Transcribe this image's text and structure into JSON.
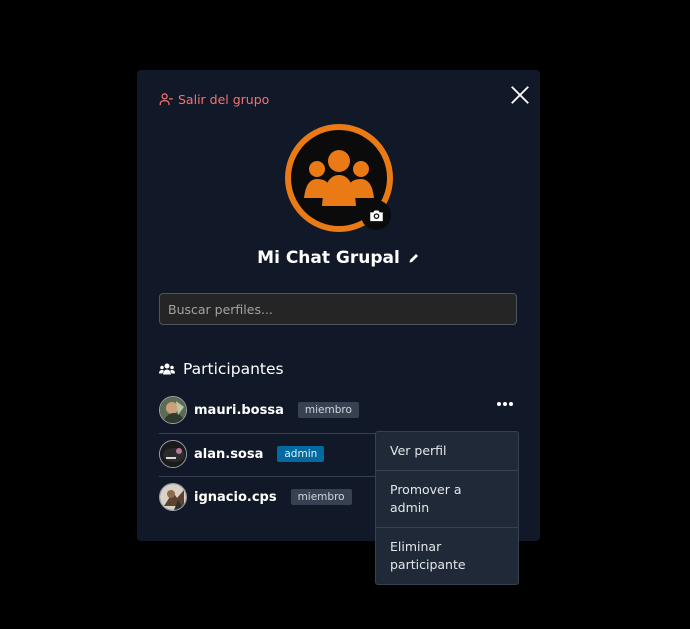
{
  "modal": {
    "leave_label": "Salir del grupo",
    "group_name": "Mi Chat Grupal",
    "search_placeholder": "Buscar perfiles...",
    "section_title": "Participantes"
  },
  "participants": [
    {
      "username": "mauri.bossa",
      "role": "miembro"
    },
    {
      "username": "alan.sosa",
      "role": "admin"
    },
    {
      "username": "ignacio.cps",
      "role": "miembro"
    }
  ],
  "context_menu": {
    "items": [
      "Ver perfil",
      "Promover a admin",
      "Eliminar participante"
    ]
  },
  "colors": {
    "accent": "#ea7a16",
    "danger": "#f87171",
    "admin_badge": "#0369a1",
    "modal_bg": "#111827"
  },
  "icons": {
    "leave": "user-minus-icon",
    "close": "close-icon",
    "camera": "camera-icon",
    "edit": "pencil-icon",
    "participants": "users-icon",
    "more": "ellipsis-icon"
  }
}
